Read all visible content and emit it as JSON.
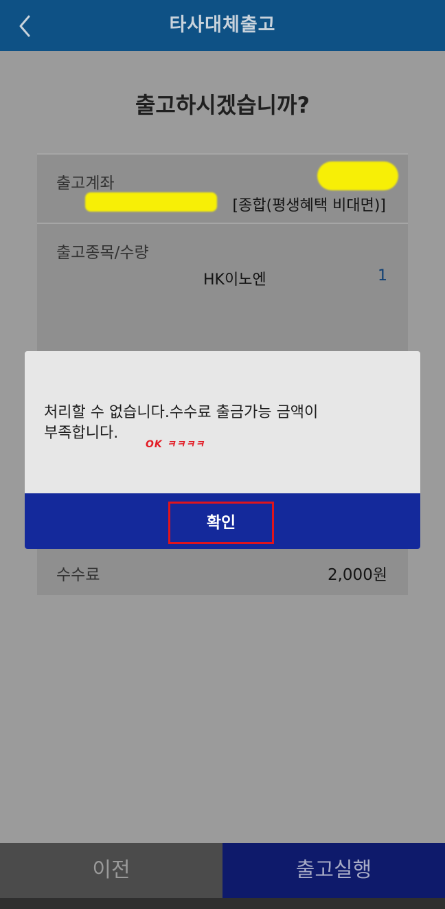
{
  "header": {
    "title": "타사대체출고",
    "back_icon": "chevron-left-icon"
  },
  "question": "출고하시겠습니까?",
  "account": {
    "label": "출고계좌",
    "type": "[종합(평생혜택 비대면)]"
  },
  "stock": {
    "label": "출고종목/수량",
    "name": "HK이노엔",
    "quantity": "1"
  },
  "fee": {
    "label": "수수료",
    "value": "2,000원"
  },
  "dialog": {
    "message": "처리할 수 없습니다.수수료 출금가능 금액이\n부족합니다.",
    "annotation": "OK ㅋㅋㅋㅋ",
    "confirm_label": "확인"
  },
  "footer": {
    "prev_label": "이전",
    "execute_label": "출고실행"
  },
  "colors": {
    "header_bg": "#0e5185",
    "dialog_button_bg": "#14299b",
    "highlight_red": "#e0141c",
    "redaction_yellow": "#f7ef06"
  }
}
